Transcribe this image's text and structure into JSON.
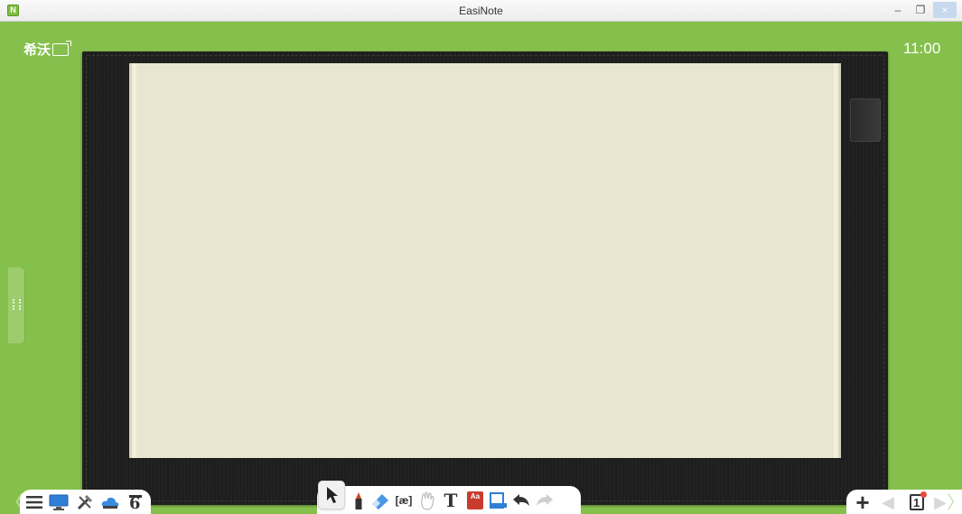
{
  "window": {
    "title": "EasiNote",
    "app_icon_letter": "N",
    "controls": {
      "minimize": "–",
      "maximize": "❐",
      "close": "×"
    }
  },
  "brand": {
    "text": "希沃"
  },
  "clock": {
    "time": "11:00"
  },
  "toolbar_left": {
    "items": [
      "menu-icon",
      "display-icon",
      "tools-icon",
      "cloud-icon",
      "tag-icon"
    ]
  },
  "toolbar_center": {
    "items": [
      "select-icon",
      "pen-icon",
      "eraser-icon",
      "phonetic-icon",
      "hand-icon",
      "text-icon",
      "dictionary-icon",
      "insert-icon",
      "undo-icon",
      "redo-icon"
    ],
    "phonetic_label": "[æ]",
    "text_label": "T",
    "dictionary_label": "Aa"
  },
  "toolbar_right": {
    "add_label": "+",
    "page_number": "1"
  },
  "colors": {
    "background": "#86c04c",
    "board": "#1f1f1f",
    "page": "#e9e6d0",
    "accent_blue": "#2f7fd6"
  }
}
